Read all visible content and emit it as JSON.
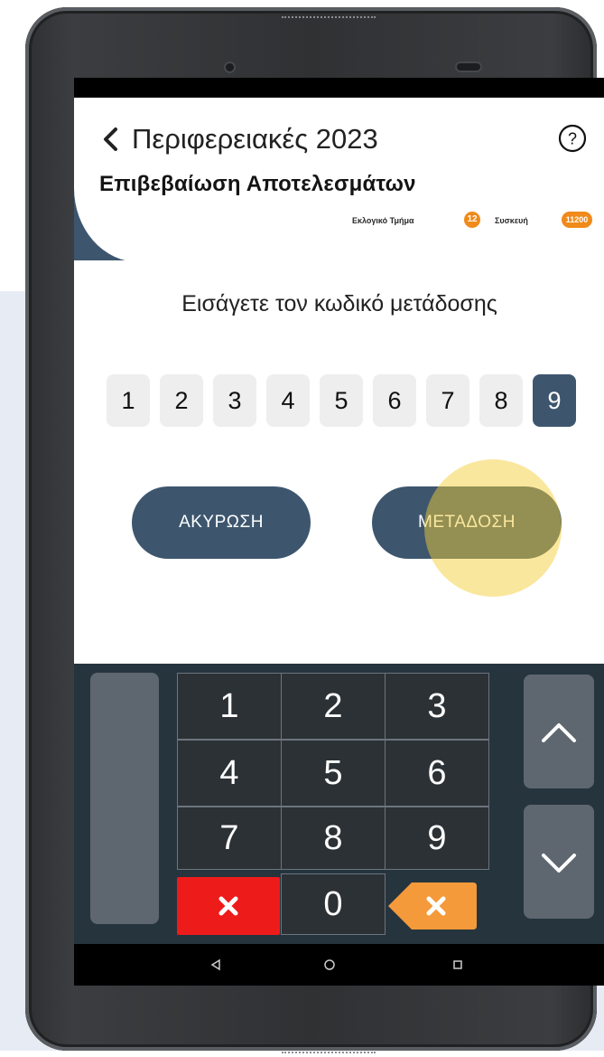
{
  "header": {
    "title": "Περιφερειακές 2023",
    "subtitle": "Επιβεβαίωση Αποτελεσμάτων",
    "precinct_label": "Εκλογικό Τμήμα",
    "precinct_value": "12",
    "device_label": "Συσκευή",
    "device_value": "11200"
  },
  "prompt": "Εισάγετε τον κωδικό μετάδοσης",
  "code_digits": [
    "1",
    "2",
    "3",
    "4",
    "5",
    "6",
    "7",
    "8",
    "9"
  ],
  "active_digit_index": 8,
  "buttons": {
    "cancel": "ΑΚΥΡΩΣΗ",
    "send": "ΜΕΤΑΔΟΣΗ"
  },
  "keypad": {
    "keys": [
      "1",
      "2",
      "3",
      "4",
      "5",
      "6",
      "7",
      "8",
      "9",
      "0"
    ],
    "clear_symbol": "✕",
    "backspace_symbol": "✕"
  },
  "colors": {
    "primary": "#3d566e",
    "accent": "#f08a1b",
    "clear_red": "#ee1b1b",
    "backspace_orange": "#f49a3a",
    "keypad_bg": "#26343e"
  },
  "icons": [
    "back-chevron-icon",
    "help-icon",
    "chevron-up-icon",
    "chevron-down-icon",
    "back-triangle-icon",
    "home-circle-icon",
    "recents-square-icon"
  ]
}
